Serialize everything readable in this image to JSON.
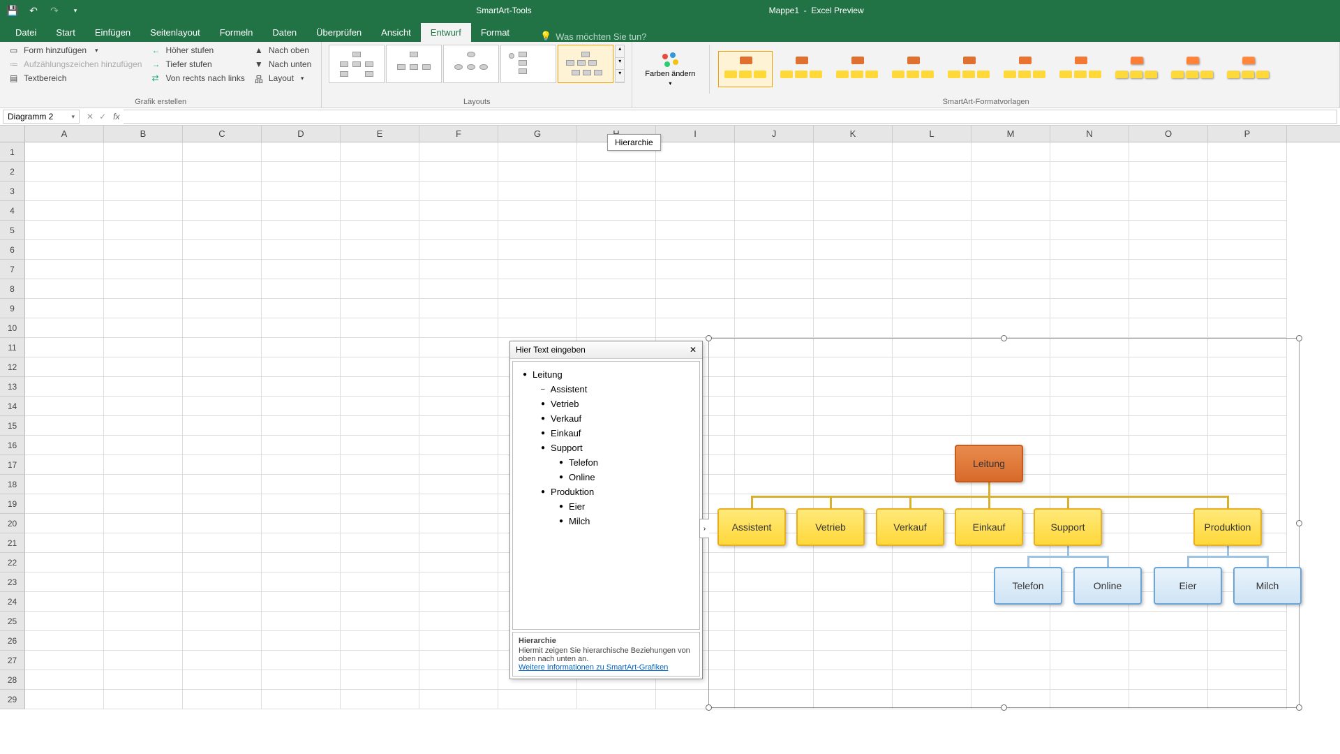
{
  "titlebar": {
    "smartart_tools": "SmartArt-Tools",
    "doc": "Mappe1",
    "app": "Excel Preview"
  },
  "tabs": {
    "datei": "Datei",
    "start": "Start",
    "einfuegen": "Einfügen",
    "seitenlayout": "Seitenlayout",
    "formeln": "Formeln",
    "daten": "Daten",
    "ueberpruefen": "Überprüfen",
    "ansicht": "Ansicht",
    "entwurf": "Entwurf",
    "format": "Format",
    "tell_me": "Was möchten Sie tun?"
  },
  "ribbon": {
    "grafik": {
      "form_hinzu": "Form hinzufügen",
      "aufz": "Aufzählungszeichen hinzufügen",
      "textbereich": "Textbereich",
      "hoeher": "Höher stufen",
      "tiefer": "Tiefer stufen",
      "rtl": "Von rechts nach links",
      "nach_oben": "Nach oben",
      "nach_unten": "Nach unten",
      "layout": "Layout",
      "group_label": "Grafik erstellen"
    },
    "layouts_label": "Layouts",
    "farben": "Farben ändern",
    "styles_label": "SmartArt-Formatvorlagen"
  },
  "tooltip": "Hierarchie",
  "namebox": "Diagramm 2",
  "columns": [
    "A",
    "B",
    "C",
    "D",
    "E",
    "F",
    "G",
    "H",
    "I",
    "J",
    "K",
    "L",
    "M",
    "N",
    "O",
    "P"
  ],
  "row_count": 29,
  "text_pane": {
    "title": "Hier Text eingeben",
    "items": [
      {
        "level": 0,
        "text": "Leitung"
      },
      {
        "level": 1,
        "text": "Assistent",
        "dash": true
      },
      {
        "level": 1,
        "text": "Vetrieb"
      },
      {
        "level": 1,
        "text": "Verkauf"
      },
      {
        "level": 1,
        "text": "Einkauf"
      },
      {
        "level": 1,
        "text": "Support"
      },
      {
        "level": 2,
        "text": "Telefon"
      },
      {
        "level": 2,
        "text": "Online"
      },
      {
        "level": 1,
        "text": "Produktion"
      },
      {
        "level": 2,
        "text": "Eier"
      },
      {
        "level": 2,
        "text": "Milch"
      }
    ],
    "footer_title": "Hierarchie",
    "footer_desc": "Hiermit zeigen Sie hierarchische Beziehungen von oben nach unten an.",
    "footer_link": "Weitere Informationen zu SmartArt-Grafiken"
  },
  "smartart": {
    "top": "Leitung",
    "mid": [
      "Assistent",
      "Vetrieb",
      "Verkauf",
      "Einkauf",
      "Support",
      "Produktion"
    ],
    "leaves": [
      "Telefon",
      "Online",
      "Eier",
      "Milch"
    ]
  },
  "style_colors": {
    "top": "#e07030",
    "bot": "#ffd83a"
  }
}
